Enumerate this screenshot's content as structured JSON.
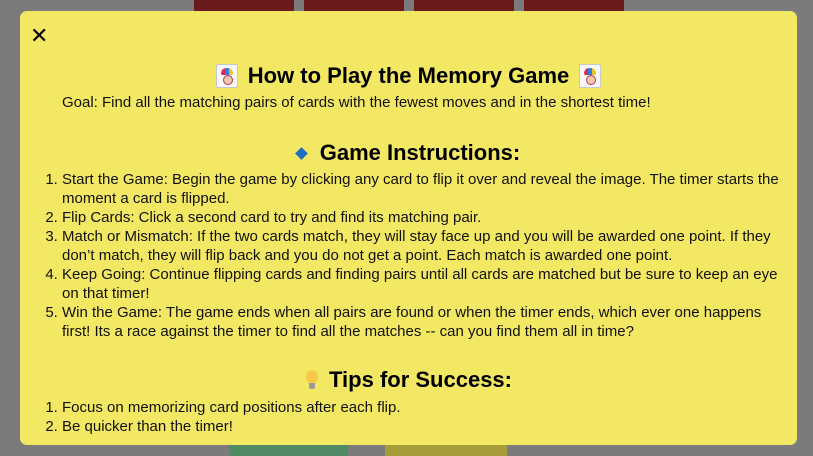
{
  "modal": {
    "close_label": "✕",
    "title": "How to Play the Memory Game",
    "goal": "Goal: Find all the matching pairs of cards with the fewest moves and in the shortest time!",
    "instructions_heading": "Game Instructions:",
    "instructions": [
      "Start the Game: Begin the game by clicking any card to flip it over and reveal the image. The timer starts the moment a card is flipped.",
      "Flip Cards: Click a second card to try and find its matching pair.",
      "Match or Mismatch: If the two cards match, they will stay face up and you will be awarded one point. If they don’t match, they will flip back and you do not get a point. Each match is awarded one point.",
      "Keep Going: Continue flipping cards and finding pairs until all cards are matched but be sure to keep an eye on that timer!",
      "Win the Game: The game ends when all pairs are found or when the timer ends, which ever one happens first! Its a race against the timer to find all the matches -- can you find them all in time?"
    ],
    "tips_heading": "Tips for Success:",
    "tips": [
      "Focus on memorizing card positions after each flip.",
      "Be quicker than the timer!"
    ]
  },
  "colors": {
    "modal_background": "#f3e864",
    "backdrop": "#7b7b7b",
    "card_back": "#6a1a1a"
  },
  "icons": {
    "title_icon": "joker-icon",
    "instructions_icon": "blue-diamond-icon",
    "tips_icon": "lightbulb-icon"
  }
}
